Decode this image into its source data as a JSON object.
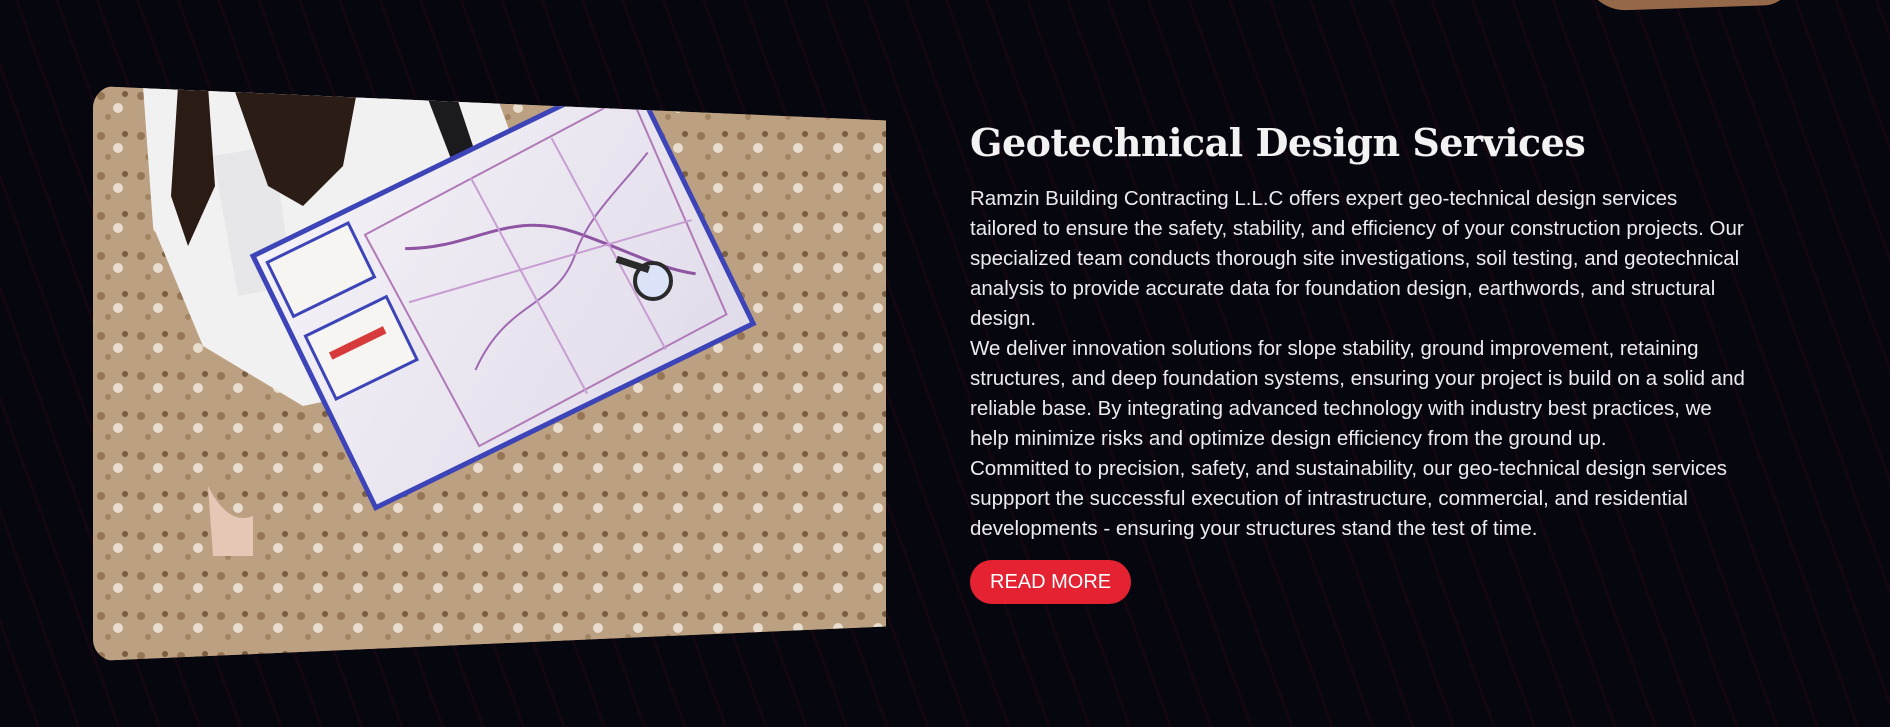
{
  "section": {
    "title": "Geotechnical Design Services",
    "paragraphs": [
      "Ramzin Building Contracting L.L.C offers expert geo-technical design services tailored to ensure the safety, stability, and efficiency of your construction projects. Our specialized team conducts thorough site investigations, soil testing, and geotechnical analysis to provide accurate data for foundation design, earthwords, and structural design.",
      "We deliver innovation solutions for slope stability, ground improvement, retaining structures, and deep foundation systems, ensuring your project is build on a solid and reliable base. By integrating advanced technology with industry best practices, we help minimize risks and optimize design efficiency from the ground up.",
      "Committed to precision, safety, and sustainability, our geo-technical design services suppport the successful execution of intrastructure, commercial, and residential developments - ensuring your structures stand the test of time."
    ],
    "button_label": "READ MORE",
    "image_subject": "woman-reading-map-on-ground"
  },
  "colors": {
    "background": "#06060f",
    "accent": "#e42232",
    "text": "#ecebf0",
    "title": "#f2f2f2"
  }
}
